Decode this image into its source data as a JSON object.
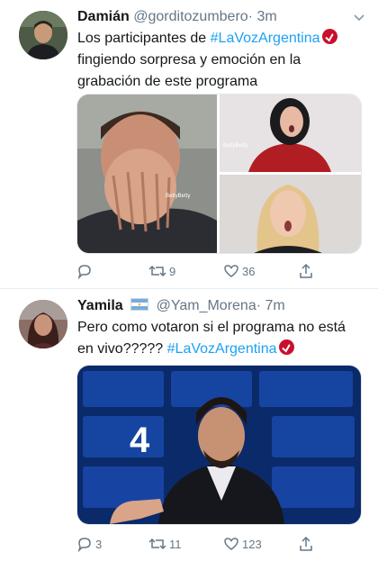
{
  "tweets": [
    {
      "name": "Damián",
      "handle": "@gorditozumbero",
      "time": "· 3m",
      "text_before": "Los participantes de ",
      "hashtag": "#LaVozArgentina",
      "text_after": " fingiendo sorpresa y emoción en la grabación de este programa",
      "media_watermarks": [
        "BettyBetty",
        "BettyBetty"
      ],
      "reply_count": "",
      "retweet_count": "9",
      "like_count": "36"
    },
    {
      "name": "Yamila",
      "handle": "@Yam_Morena",
      "time": "· 7m",
      "text_before": "Pero como votaron si el programa no está en vivo????? ",
      "hashtag": "#LaVozArgentina",
      "text_after": "",
      "media_number": "4",
      "reply_count": "3",
      "retweet_count": "11",
      "like_count": "123"
    }
  ],
  "icons": {
    "reply": "reply-icon",
    "retweet": "retweet-icon",
    "like": "heart-icon",
    "share": "share-icon",
    "menu": "chevron-down-icon"
  },
  "colors": {
    "hashtag": "#1da1f2",
    "muted": "#657786",
    "badge": "#c8102e"
  }
}
